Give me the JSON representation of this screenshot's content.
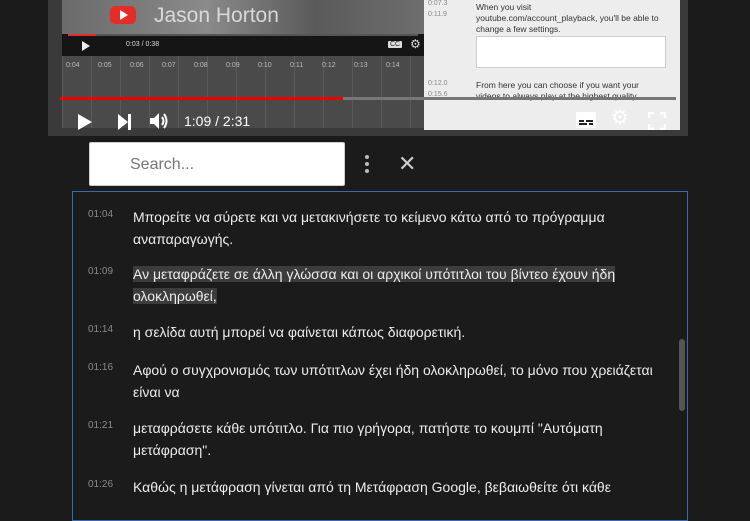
{
  "video": {
    "presenter_name": "Jason Horton",
    "inner_time": "0:03 / 0:38",
    "inner_progress_fraction": 0.08,
    "inner_cc_label": "CC",
    "timeline_ticks": [
      "0:04",
      "0:05",
      "0:06",
      "0:07",
      "0:08",
      "0:09",
      "0:10",
      "0:11",
      "0:12",
      "0:13",
      "0:14"
    ],
    "transcript_panel": [
      {
        "time": "0:07.3",
        "text": "When you visit"
      },
      {
        "time": "0:11.9",
        "text": "youtube.com/account_playback, you'll be able to change a few settings."
      },
      {
        "time": "0:12.0",
        "text": "From here you can choose if you want your"
      },
      {
        "time": "0:15.6",
        "text": "videos to always play at the highest quality."
      }
    ]
  },
  "player": {
    "time_display": "1:09 / 2:31",
    "progress_fraction": 0.46,
    "colors": {
      "progress": "#ee0000",
      "accent": "#3a69b0"
    }
  },
  "search": {
    "placeholder": "Search..."
  },
  "transcript": [
    {
      "time": "01:04",
      "text": "Μπορείτε να σύρετε και να μετακινήσετε το κείμενο κάτω από το πρόγραμμα αναπαραγωγής."
    },
    {
      "time": "01:09",
      "text": "Αν μεταφράζετε σε άλλη γλώσσα και οι αρχικοί υπότιτλοι του βίντεο έχουν ήδη ολοκληρωθεί,",
      "highlighted": true
    },
    {
      "time": "01:14",
      "text": "η σελίδα αυτή μπορεί να φαίνεται κάπως διαφορετική."
    },
    {
      "time": "01:16",
      "text": "Αφού ο συγχρονισμός των υπότιτλων έχει ήδη ολοκληρωθεί, το μόνο που χρειάζεται είναι να"
    },
    {
      "time": "01:21",
      "text": "μεταφράσετε κάθε υπότιτλο. Για πιο γρήγορα, πατήστε το κουμπί \"Αυτόματη μετάφραση\"."
    },
    {
      "time": "01:26",
      "text": "Καθώς η μετάφραση γίνεται από τη Μετάφραση Google, βεβαιωθείτε ότι κάθε"
    }
  ],
  "icons": {
    "play": "play-icon",
    "next": "next-icon",
    "volume": "volume-icon",
    "subtitles": "subtitles-icon",
    "settings": "gear-icon",
    "fullscreen": "fullscreen-icon",
    "more": "more-vertical-icon",
    "close": "close-icon"
  }
}
